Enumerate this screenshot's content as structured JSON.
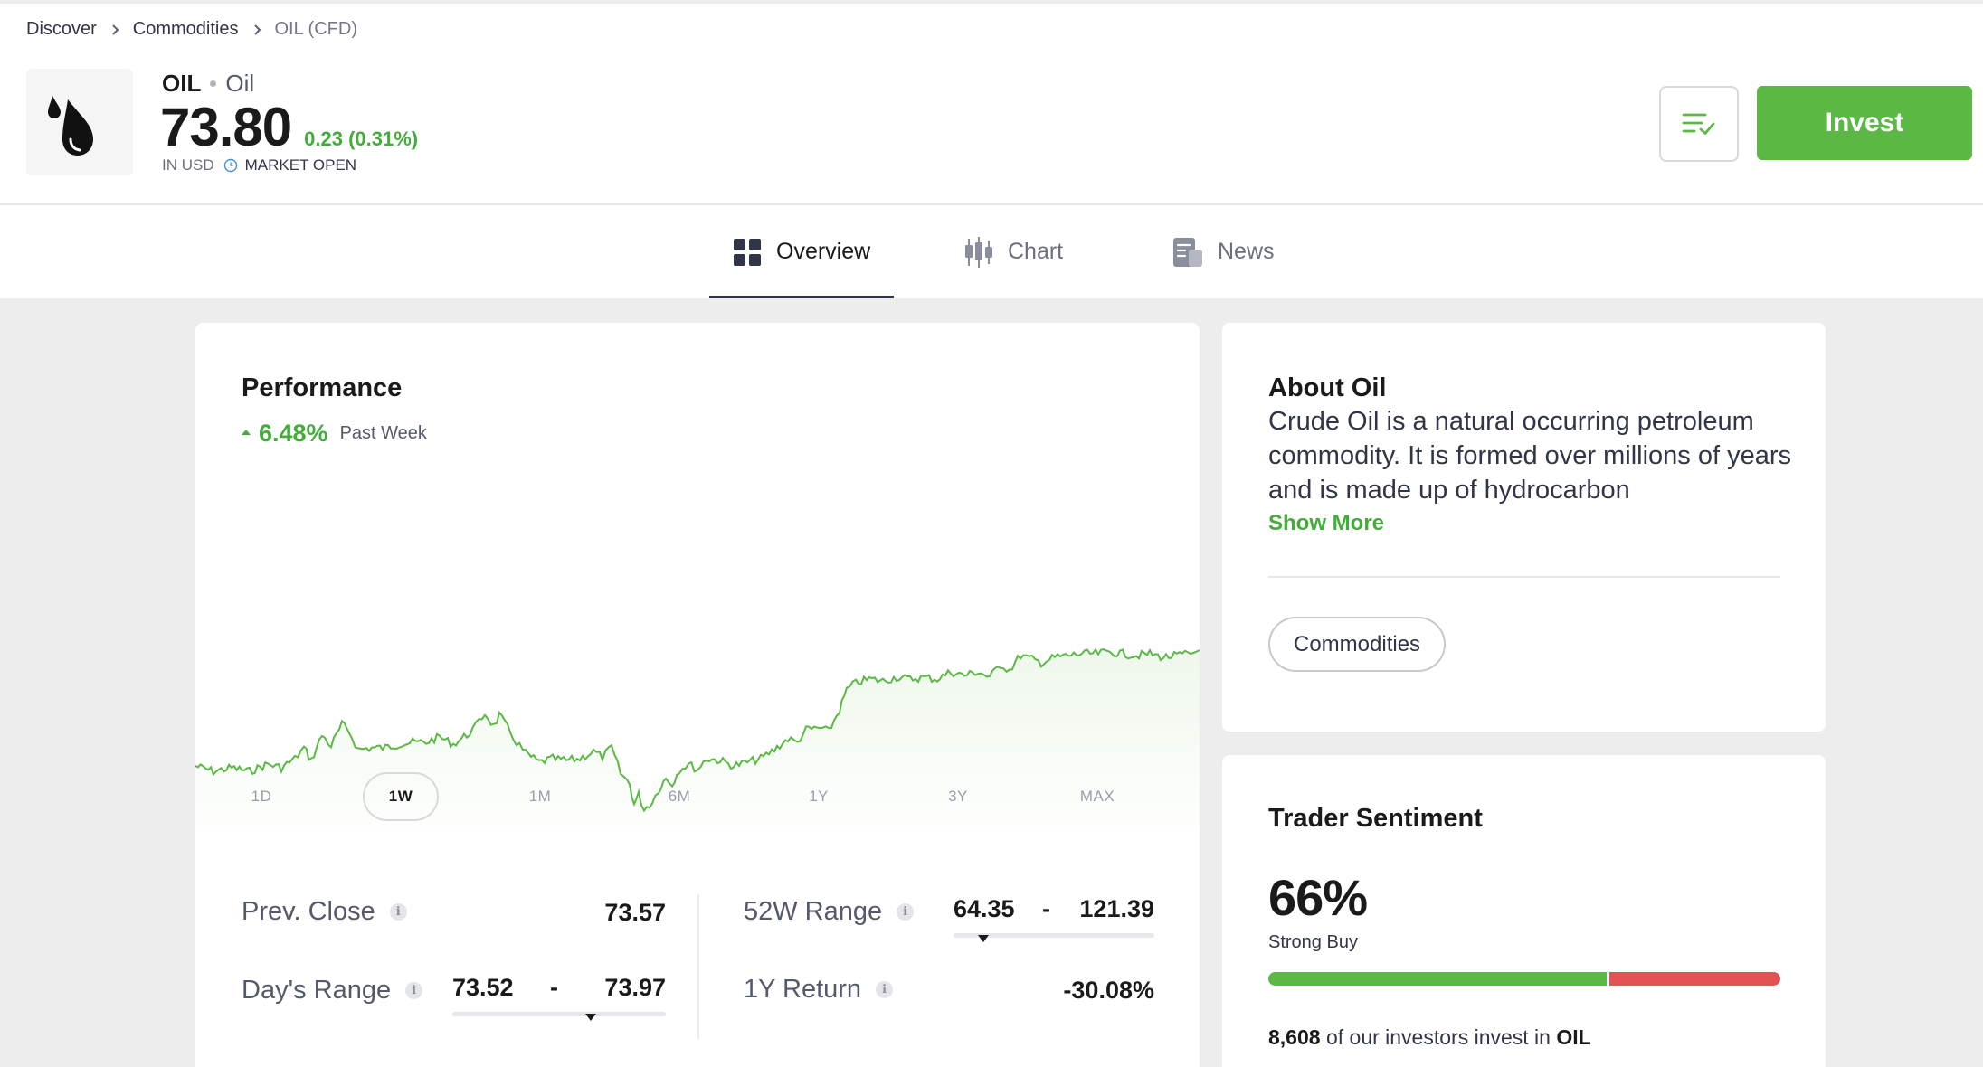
{
  "breadcrumb": {
    "items": [
      "Discover",
      "Commodities",
      "OIL (CFD)"
    ]
  },
  "instrument": {
    "symbol": "OIL",
    "name": "Oil",
    "price": "73.80",
    "change": "0.23 (0.31%)",
    "currency": "IN USD",
    "market_status": "MARKET OPEN",
    "logo_icon": "oil-drops-icon"
  },
  "actions": {
    "watchlist_icon": "watchlist-check-icon",
    "invest_label": "Invest"
  },
  "tabs": [
    {
      "label": "Overview",
      "icon": "grid-icon",
      "active": true
    },
    {
      "label": "Chart",
      "icon": "candlestick-icon",
      "active": false
    },
    {
      "label": "News",
      "icon": "news-icon",
      "active": false
    }
  ],
  "performance": {
    "title": "Performance",
    "change_pct": "6.48%",
    "change_label": "Past Week",
    "periods": [
      "1D",
      "1W",
      "1M",
      "6M",
      "1Y",
      "3Y",
      "MAX"
    ],
    "active_period": "1W"
  },
  "stats": {
    "prev_close": {
      "label": "Prev. Close",
      "value": "73.57"
    },
    "days_range": {
      "label": "Day's Range",
      "low": "73.52",
      "high": "73.97",
      "separator": "-",
      "position": 0.65
    },
    "range_52w": {
      "label": "52W Range",
      "low": "64.35",
      "high": "121.39",
      "separator": "-",
      "position": 0.15
    },
    "return_1y": {
      "label": "1Y Return",
      "value": "-30.08%"
    },
    "info_glyph": "i"
  },
  "about": {
    "title": "About Oil",
    "text": "Crude Oil is a natural occurring petroleum commodity. It is formed over millions of years and is made up of hydrocarbon",
    "show_more": "Show More",
    "tag": "Commodities"
  },
  "sentiment": {
    "title": "Trader Sentiment",
    "percent": "66%",
    "buy_fraction": 0.66,
    "label": "Strong Buy",
    "investors_count": "8,608",
    "investors_text": "of our investors invest in",
    "investors_symbol": "OIL"
  },
  "colors": {
    "accent_green": "#5bb844",
    "price_green": "#43ad3a",
    "sell_red": "#e35252",
    "text_dark": "#1a1a1a",
    "background": "#ededed"
  }
}
